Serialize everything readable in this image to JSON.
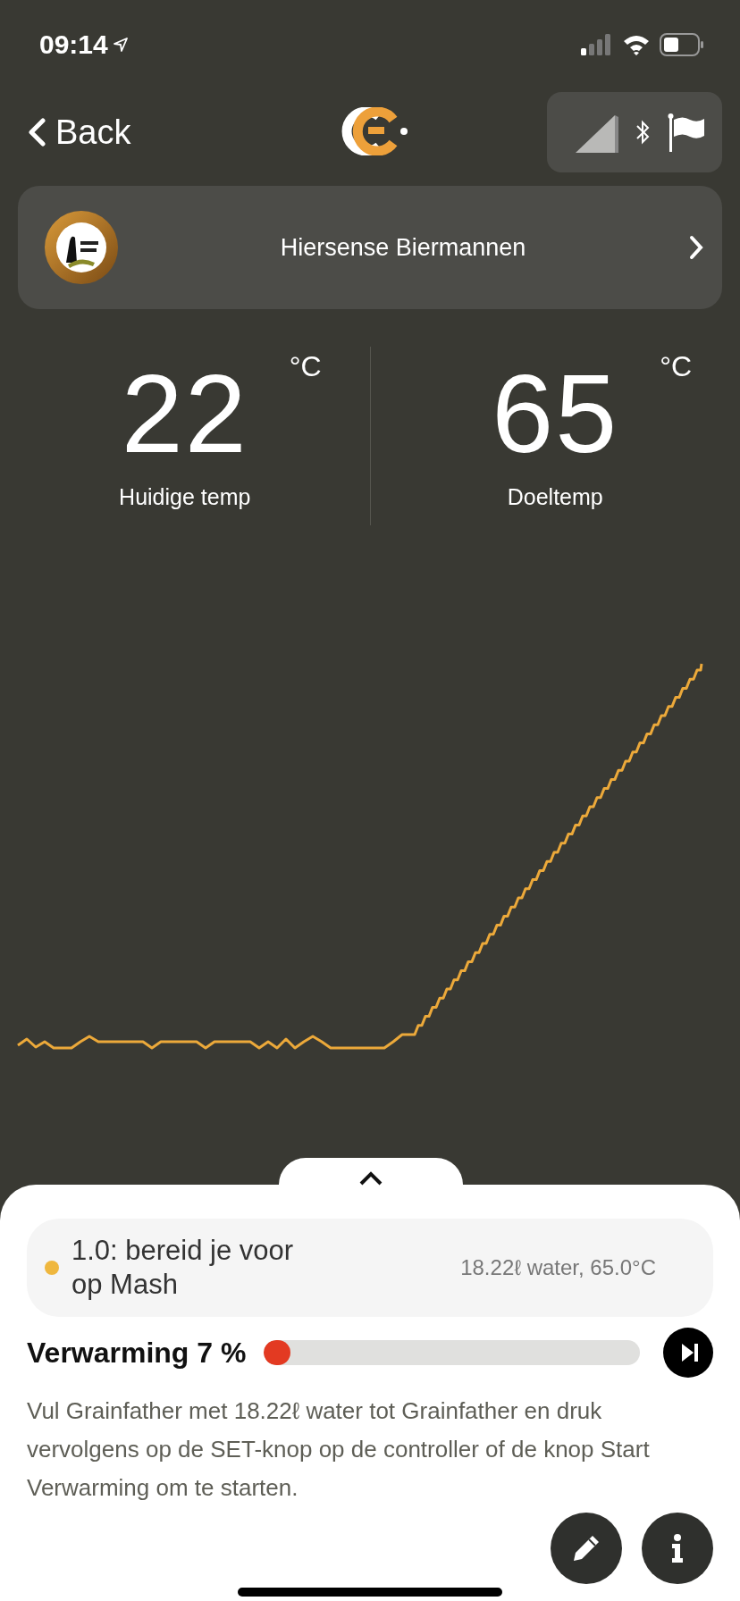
{
  "status_bar": {
    "time": "09:14"
  },
  "nav": {
    "back": "Back"
  },
  "brewery": {
    "name": "Hiersense Biermannen"
  },
  "temperatures": [
    {
      "value": "22",
      "unit": "°C",
      "label": "Huidige temp"
    },
    {
      "value": "65",
      "unit": "°C",
      "label": "Doeltemp"
    }
  ],
  "step": {
    "title": "1.0: bereid je voor op Mash",
    "color": "#efb73e",
    "details": "18.22ℓ water, 65.0°C"
  },
  "heating": {
    "label": "Verwarming 7 %",
    "level": 0.07
  },
  "description": "Vul Grainfather met 18.22ℓ water tot Grainfather en druk vervolgens op de SET-knop op de controller of de knop Start Verwarming om te starten."
}
